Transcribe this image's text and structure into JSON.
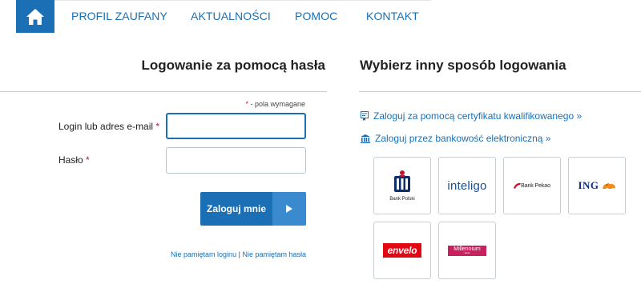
{
  "nav": {
    "items": [
      {
        "label": "PROFIL ZAUFANY"
      },
      {
        "label": "AKTUALNOŚCI"
      },
      {
        "label": "POMOC"
      },
      {
        "label": "KONTAKT"
      }
    ]
  },
  "login": {
    "heading": "Logowanie za pomocą hasła",
    "required_star": "*",
    "required_note": " - pola wymagane",
    "login_label": "Login lub adres e-mail",
    "password_label": "Hasło",
    "submit_label": "Zaloguj mnie",
    "forgot_login": "Nie pamiętam loginu",
    "separator": "|",
    "forgot_password": "Nie pamiętam hasła"
  },
  "other": {
    "heading": "Wybierz inny sposób logowania",
    "cert_link": "Zaloguj za pomocą certyfikatu kwalifikowanego »",
    "bank_link": "Zaloguj przez bankowość elektroniczną »",
    "banks": {
      "pko": "Bank Polski",
      "inteligo": "inteligo",
      "pekao": "Bank Pekao",
      "ing": "ING",
      "envelo": "envelo",
      "millennium": "Millennium",
      "millennium_sub": "bank"
    }
  },
  "colors": {
    "brand_blue": "#1a6fb5",
    "required_red": "#c8102e"
  },
  "icons": {
    "home": "home-icon",
    "certificate": "certificate-icon",
    "bank": "bank-icon",
    "submit_arrow": "play-arrow-icon"
  }
}
